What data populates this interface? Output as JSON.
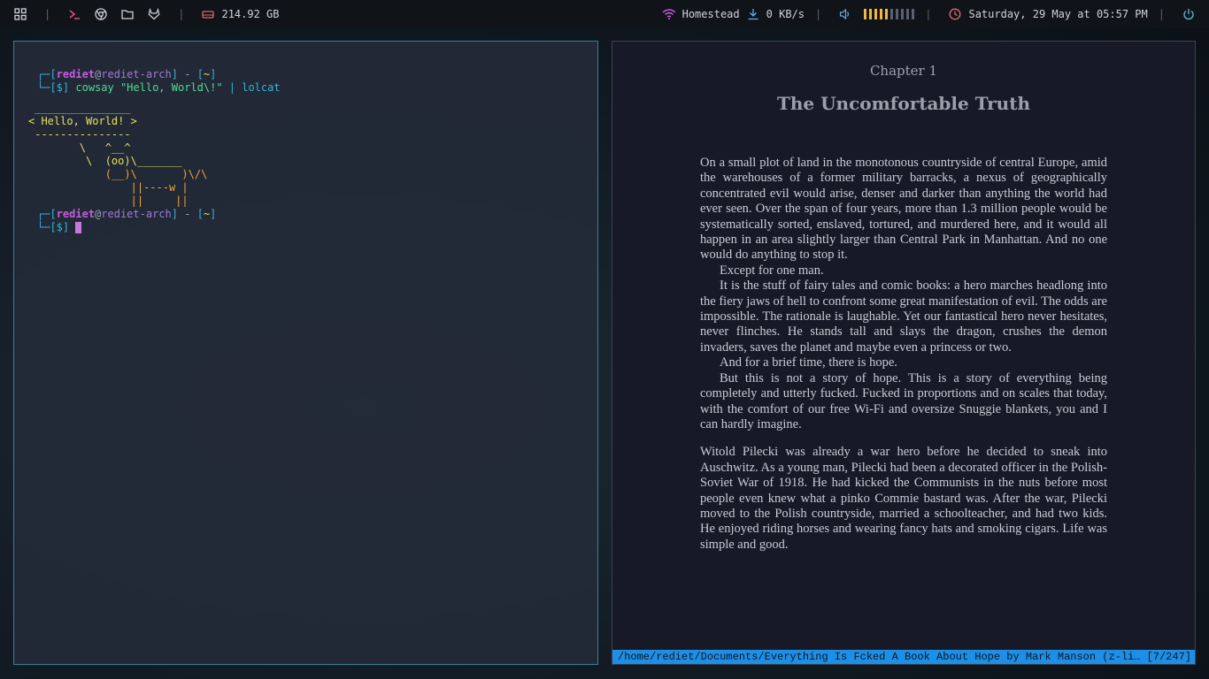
{
  "topbar": {
    "disk": "214.92 GB",
    "network": "Homestead",
    "net_speed": "0 KB/s",
    "volume_level": 0.5,
    "datetime": "Saturday, 29 May at 05:57 PM"
  },
  "terminal": {
    "prompt_user": "rediet",
    "prompt_at": "@",
    "prompt_host": "rediet-arch",
    "prompt_dir": "~",
    "prompt_dollar": "[$]",
    "command": "cowsay \"Hello, World\\!\"",
    "pipe": "| lolcat",
    "cow_lines": [
      " _______________",
      "< Hello, World! >",
      " ---------------",
      "        \\   ^__^",
      "         \\  (oo)\\_______",
      "            (__)\\       )\\/\\",
      "                ||----w |",
      "                ||     ||"
    ]
  },
  "reader": {
    "chapter_label": "Chapter 1",
    "chapter_title": "The Uncomfortable Truth",
    "paragraphs": [
      "On a small plot of land in the monotonous countryside of central Europe, amid the warehouses of a former military barracks, a nexus of geographically concentrated evil would arise, denser and darker than anything the world had ever seen. Over the span of four years, more than 1.3 million people would be systematically sorted, enslaved, tortured, and murdered here, and it would all happen in an area slightly larger than Central Park in Manhattan. And no one would do anything to stop it.",
      "Except for one man.",
      "It is the stuff of fairy tales and comic books: a hero marches headlong into the fiery jaws of hell to confront some great manifestation of evil. The odds are impossible. The rationale is laughable. Yet our fantastical hero never hesitates, never flinches. He stands tall and slays the dragon, crushes the demon invaders, saves the planet and maybe even a princess or two.",
      "And for a brief time, there is hope.",
      "But this is not a story of hope. This is a story of everything being completely and utterly fucked. Fucked in proportions and on scales that today, with the comfort of our free Wi-Fi and oversize Snuggie blankets, you and I can hardly imagine.",
      "Witold Pilecki was already a war hero before he decided to sneak into Auschwitz. As a young man, Pilecki had been a decorated officer in the Polish-Soviet War of 1918. He had kicked the Communists in the nuts before most people even knew what a pinko Commie bastard was. After the war, Pilecki moved to the Polish countryside, married a schoolteacher, and had two kids. He enjoyed riding horses and wearing fancy hats and smoking cigars. Life was simple and good."
    ],
    "status_path": "/home/rediet/Documents/Everything Is Fcked A Book About Hope by Mark Manson (z-lib.org).epub",
    "status_page": "[7/247]"
  },
  "colors": {
    "bar_bg": "#101318",
    "terminal_border": "#3a7d97",
    "status_bar": "#1e8fe6",
    "volume_on": "#f3b63f"
  }
}
